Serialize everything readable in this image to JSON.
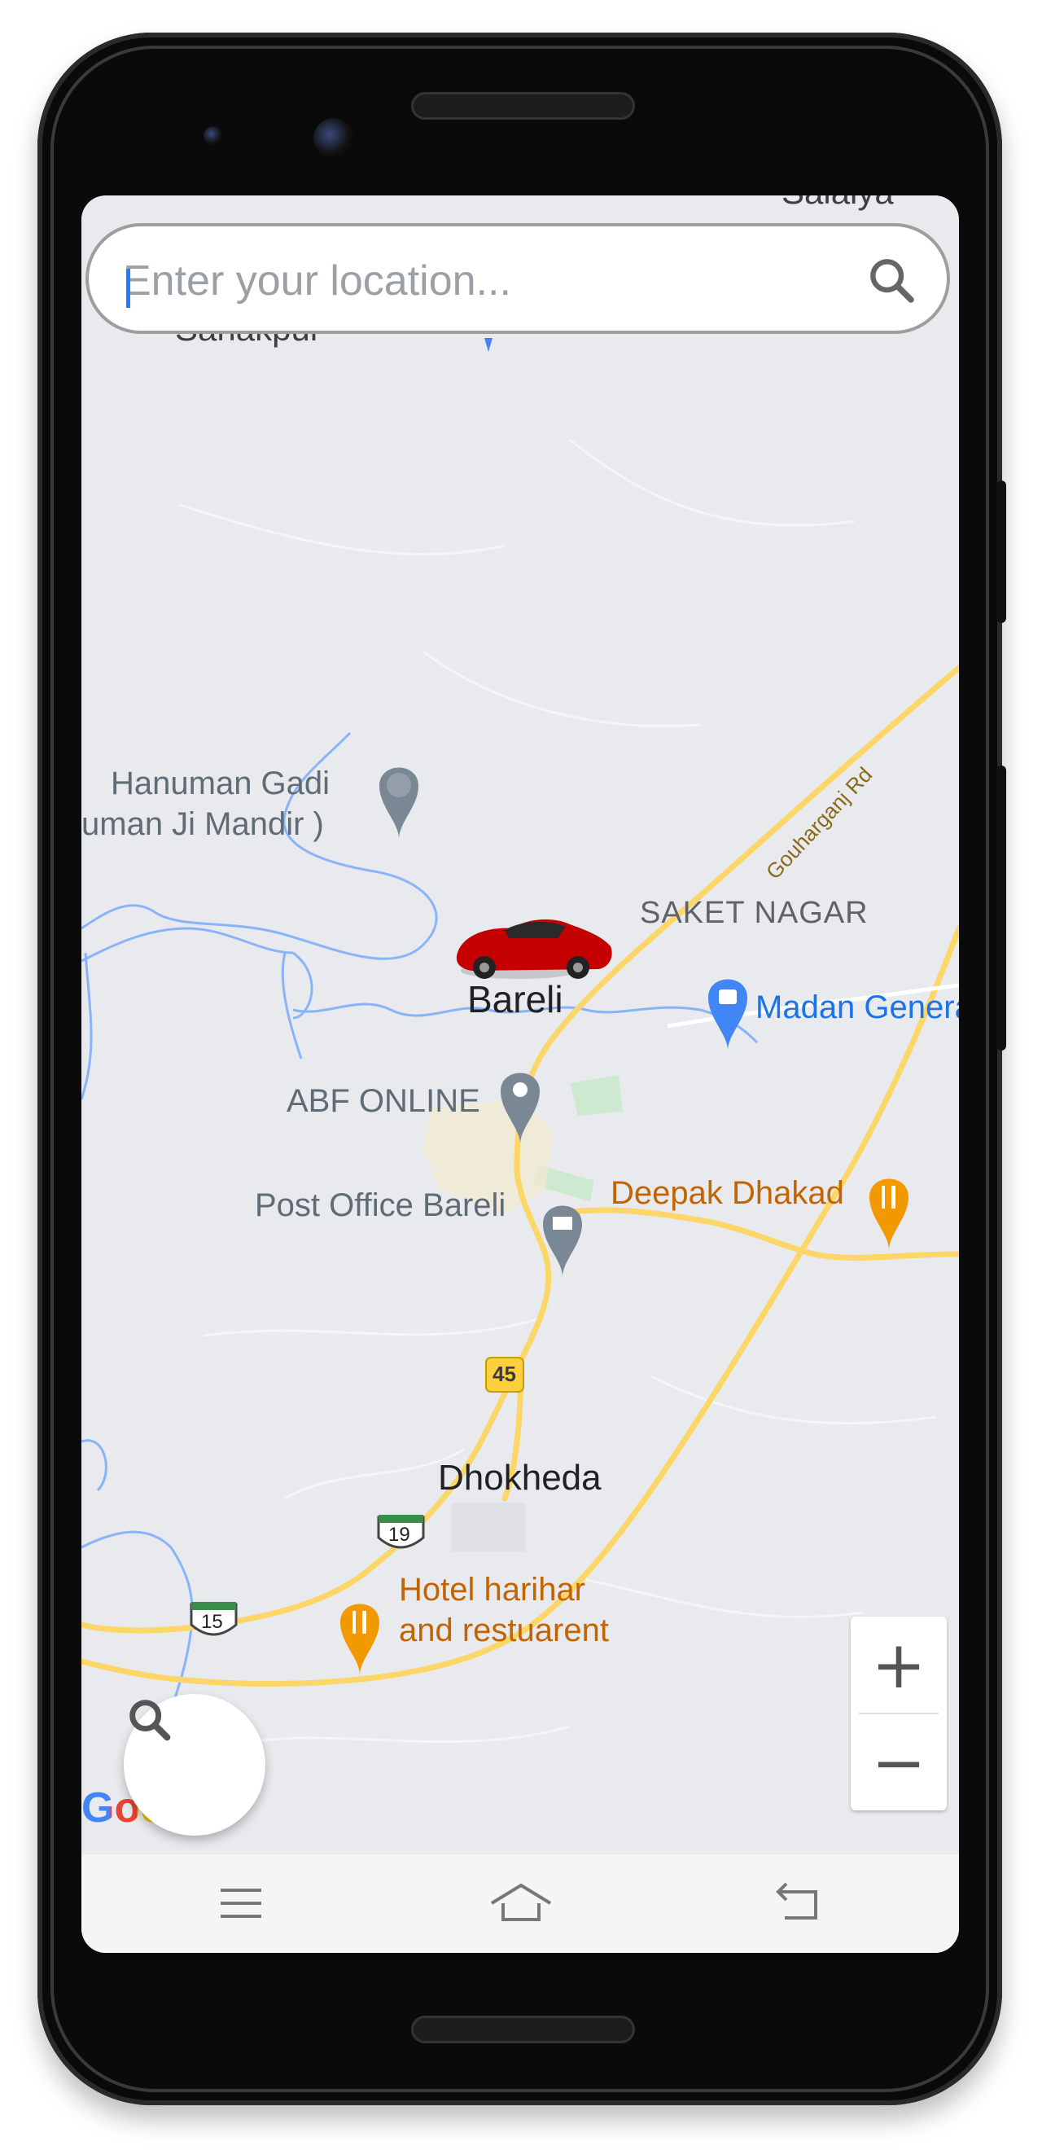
{
  "search": {
    "placeholder": "Enter your location..."
  },
  "map": {
    "places": {
      "hanuman_line1": "Hanuman Gadi",
      "hanuman_line2": "uman Ji Mandir )",
      "saket_nagar": "SAKET NAGAR",
      "bareli": "Bareli",
      "madan": "Madan General S",
      "abf": "ABF ONLINE",
      "post_office": "Post Office Bareli",
      "deepak": "Deepak Dhakad",
      "dhokheda": "Dhokheda",
      "hotel_line1": "Hotel harihar",
      "hotel_line2": "and restuarent",
      "gouharganj": "Gouharganj Rd",
      "top_left_cut": "Sahakpur",
      "top_right_cut": "Salaiya"
    },
    "shields": {
      "nh45": "45",
      "nh19": "19",
      "nh15": "15"
    },
    "google_logo": "Goo",
    "colors": {
      "map_bg": "#e8eaed",
      "road": "#fcd667",
      "water": "#8ab4f8",
      "poi_restaurant": "#f29900",
      "poi_shopping": "#4285f4",
      "poi_generic": "#7a8896",
      "car": "#c40000"
    }
  },
  "zoom": {
    "in": "+",
    "out": "−"
  },
  "navigation": {
    "icons": [
      "menu-icon",
      "home-icon",
      "back-icon"
    ]
  }
}
